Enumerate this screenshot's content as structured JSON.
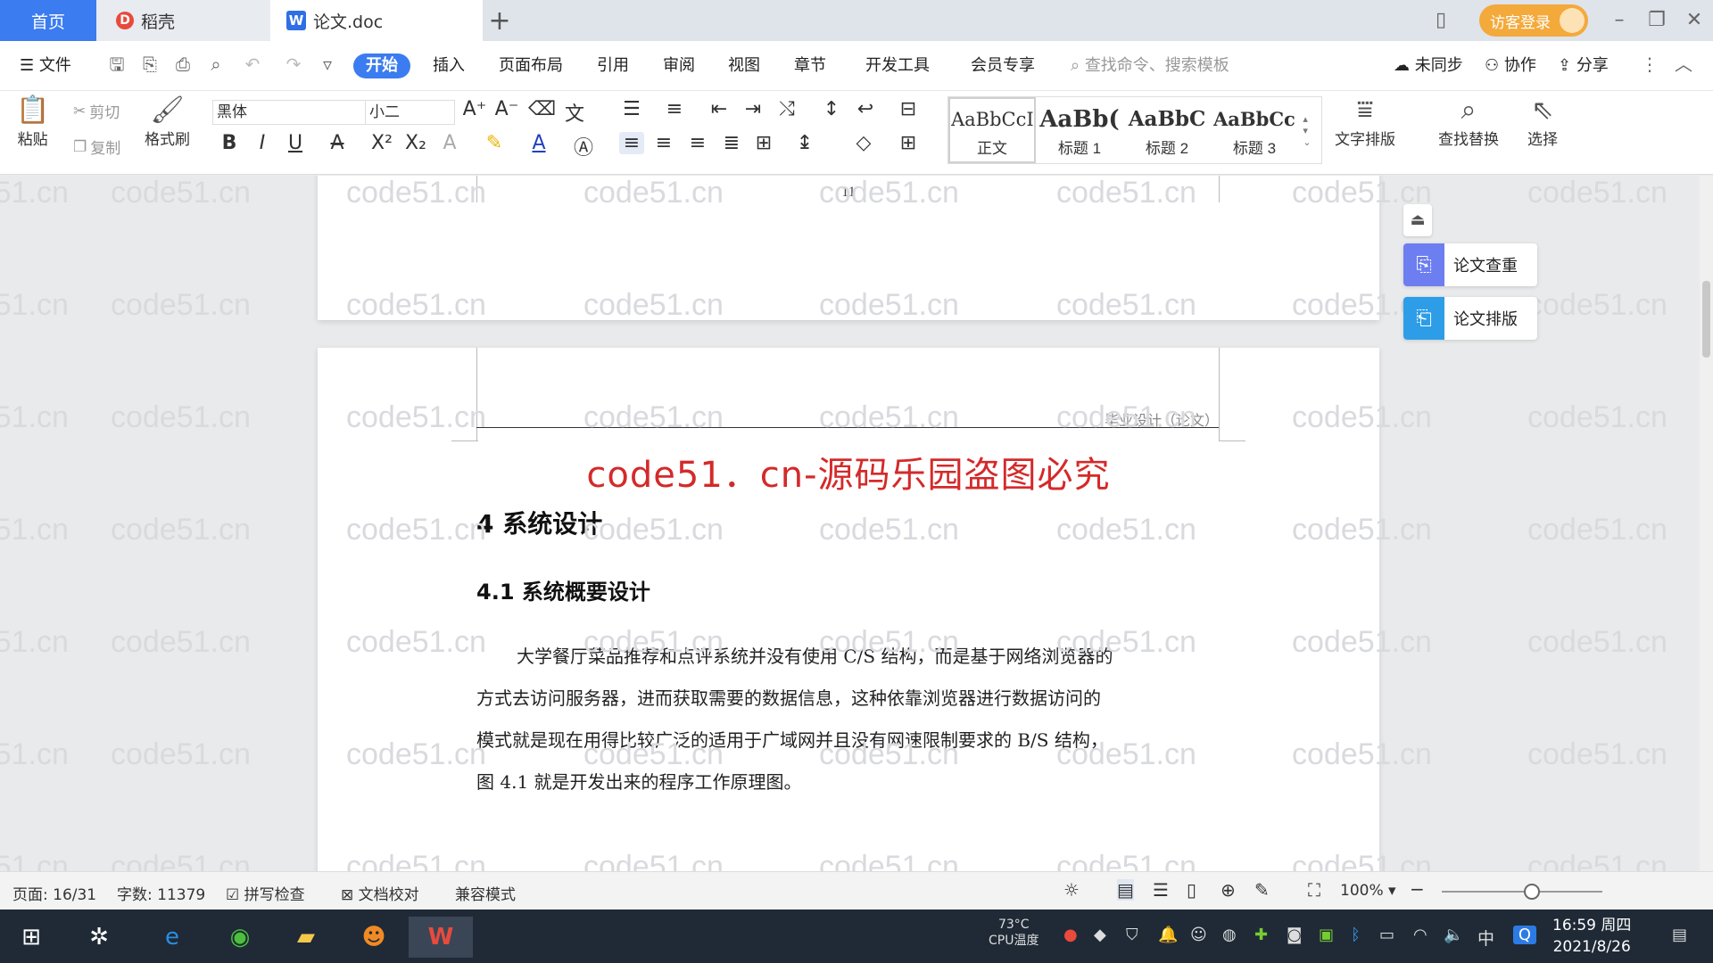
{
  "tabs": {
    "home": "首页",
    "daoke": "稻壳",
    "doc": "论文.doc",
    "login": "访客登录"
  },
  "menu": {
    "file": "文件",
    "items": [
      "开始",
      "插入",
      "页面布局",
      "引用",
      "审阅",
      "视图",
      "章节",
      "开发工具",
      "会员专享"
    ],
    "search_placeholder": "查找命令、搜索模板",
    "sync": "未同步",
    "collab": "协作",
    "share": "分享"
  },
  "ribbon": {
    "paste": "粘贴",
    "cut": "剪切",
    "copy": "复制",
    "format_painter": "格式刷",
    "font": "黑体",
    "size": "小二",
    "styles": [
      {
        "preview": "AaBbCcI",
        "name": "正文"
      },
      {
        "preview": "AaBb(",
        "name": "标题 1"
      },
      {
        "preview": "AaBbC",
        "name": "标题 2"
      },
      {
        "preview": "AaBbCcI",
        "name": "标题 3"
      }
    ],
    "text_layout": "文字排版",
    "find_replace": "查找替换",
    "select": "选择"
  },
  "side_panel": {
    "check": "论文查重",
    "format": "论文排版"
  },
  "document": {
    "prev_page_number": "11",
    "header": "毕业设计（论文）",
    "watermark_title": "code51．cn-源码乐园盗图必究",
    "chapter": "4  系统设计",
    "section": "4.1 系统概要设计",
    "paragraph_lines": [
      "大学餐厅菜品推荐和点评系统并没有使用 C/S 结构，而是基于网络浏览器的",
      "方式去访问服务器，进而获取需要的数据信息，这种依靠浏览器进行数据访问的",
      "模式就是现在用得比较广泛的适用于广域网并且没有网速限制要求的 B/S 结构，",
      "图 4.1 就是开发出来的程序工作原理图。"
    ],
    "bg_watermark": "code51.cn"
  },
  "status": {
    "page": "页面: 16/31",
    "words": "字数: 11379",
    "spell": "拼写检查",
    "proof": "文档校对",
    "compat": "兼容模式",
    "zoom": "100%"
  },
  "taskbar": {
    "cpu_temp": "73°C",
    "cpu_label": "CPU温度",
    "input": "中",
    "time": "16:59 周四",
    "date": "2021/8/26"
  },
  "colors": {
    "accent": "#3b7cf0",
    "watermark_red": "#d42a2a",
    "login": "#f4a93b"
  }
}
